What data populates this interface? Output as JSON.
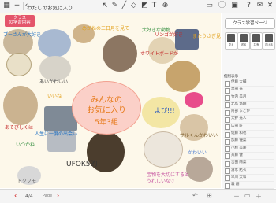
{
  "toolbar": {
    "document_title": "わたしのお気に入り"
  },
  "canvas": {
    "class_tab": [
      "クラス",
      "の学習内容"
    ],
    "center_title": [
      "みんなの",
      "お気に入り",
      "5年3組"
    ],
    "handwriting": [
      "プーさんが大好き",
      "めがねの三日月を見て",
      "大好きな動物",
      "リンゴが好き",
      "またうさぎ見たい",
      "ホワイトボードが",
      "あいかわいい",
      "いいね",
      "よぴ!!!",
      "サルくんかわいい",
      "かわいい",
      "あそびしくは",
      "UFOK5的",
      "ドクソモ",
      "いつかね",
      "人生に一度の出会い",
      "宝物を大切にすると",
      "うれしいな♡"
    ]
  },
  "sidebar": {
    "class_page_button": "クラス学習ページ",
    "mode_buttons": [
      "見る",
      "送る",
      "共有",
      "広げる"
    ],
    "list_header": "個別表示",
    "students": [
      "伊藤 大輔",
      "黒田 光",
      "竹内 美月",
      "北島 悠翔",
      "阿部 まどか",
      "大野 光人",
      "広田 匠",
      "佐藤 和也",
      "加藤 優菜",
      "小林 美咲",
      "斉藤 健",
      "吉田 陽菜",
      "清水 結衣",
      "早川 大和",
      "森 翔",
      "中村 あかり"
    ]
  },
  "pager": {
    "page": "4/4",
    "page_word": "Page"
  },
  "colors": {
    "accent": "#e4556b",
    "canvas_bg": "#fdf8ea",
    "title_orange": "#e77a1a"
  }
}
